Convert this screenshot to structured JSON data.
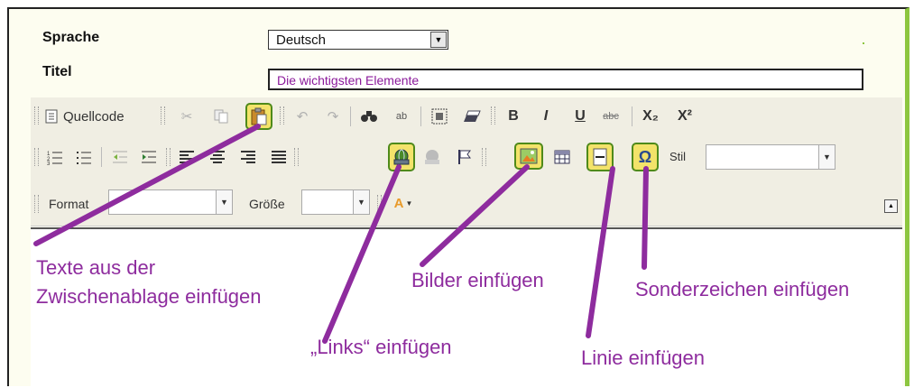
{
  "form": {
    "language_label": "Sprache",
    "language_value": "Deutsch",
    "title_label": "Titel",
    "title_value": "Die wichtigsten Elemente"
  },
  "toolbar": {
    "row1": {
      "source": "Quellcode",
      "bold": "B",
      "italic": "I",
      "underline": "U",
      "strike": "abc",
      "subscript": "X₂",
      "superscript": "X²"
    },
    "row2": {
      "style_label": "Stil",
      "style_value": ""
    },
    "row3": {
      "format_label": "Format",
      "format_value": "",
      "size_label": "Größe",
      "size_value": "",
      "color_glyph": "A"
    }
  },
  "annotations": {
    "paste": [
      "Texte aus der",
      "Zwischenablage einfügen"
    ],
    "links": "„Links“ einfügen",
    "images": "Bilder einfügen",
    "line": "Linie einfügen",
    "special": "Sonderzeichen einfügen"
  },
  "colors": {
    "annotation": "#8e2c9e",
    "highlight": "#f3e36a",
    "frame_accent": "#8dc63f"
  }
}
